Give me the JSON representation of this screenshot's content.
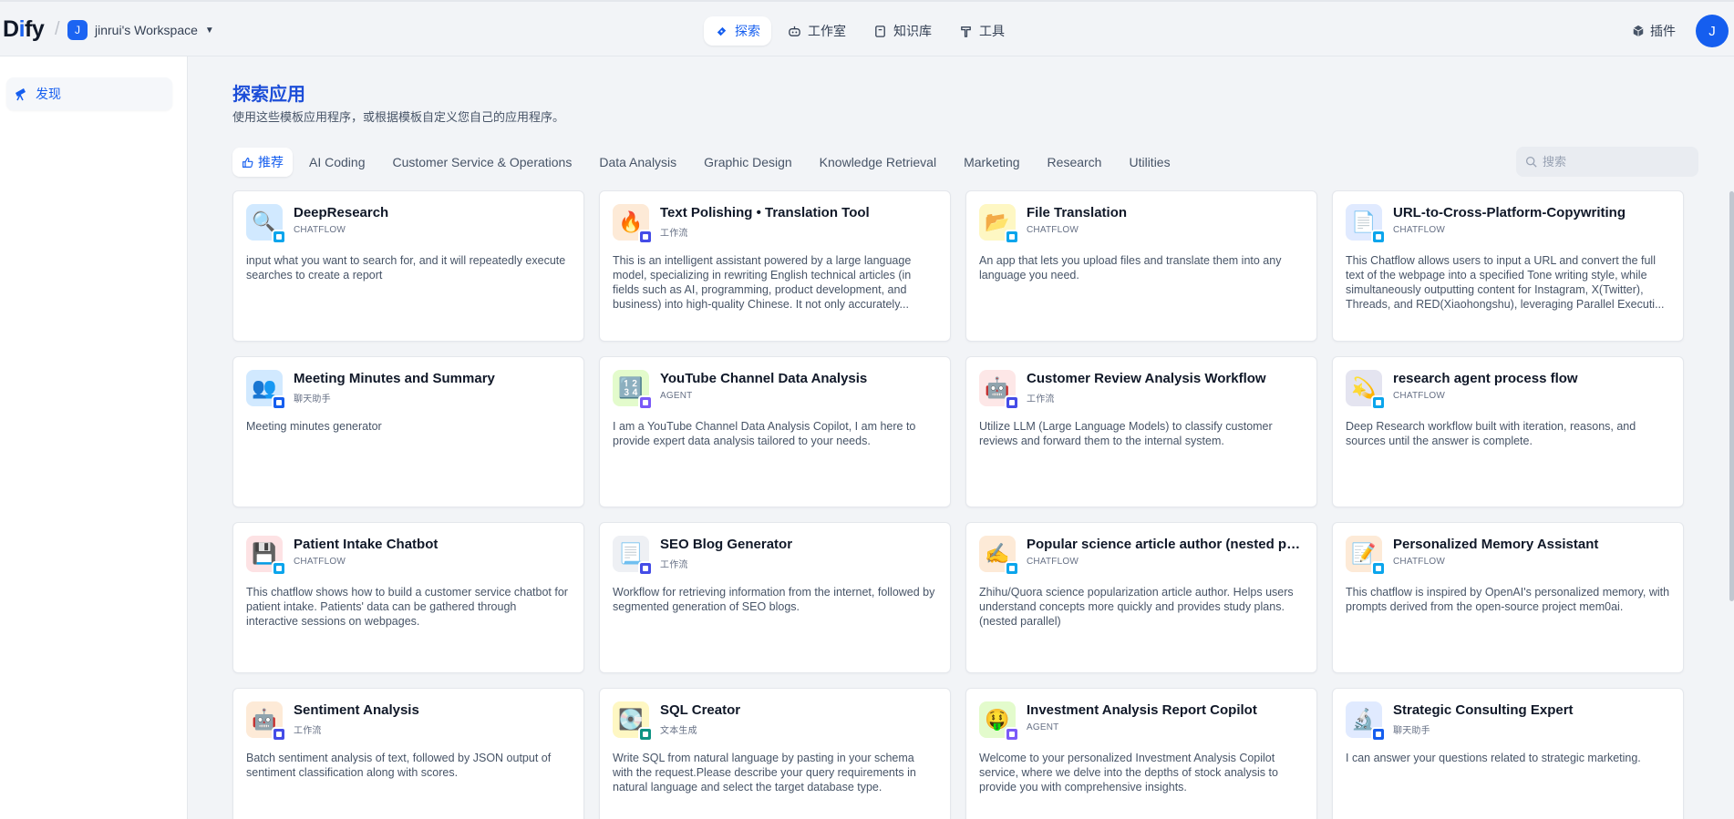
{
  "header": {
    "logo_prefix": "D",
    "logo_i": "i",
    "logo_suffix": "fy",
    "workspace_initial": "J",
    "workspace_name": "jinrui's Workspace",
    "nav": [
      {
        "label": "探索",
        "icon": "compass-icon",
        "active": true
      },
      {
        "label": "工作室",
        "icon": "robot-icon",
        "active": false
      },
      {
        "label": "知识库",
        "icon": "book-icon",
        "active": false
      },
      {
        "label": "工具",
        "icon": "hammer-icon",
        "active": false
      }
    ],
    "plugin_label": "插件",
    "user_initial": "J"
  },
  "sidebar": {
    "items": [
      {
        "label": "发现",
        "icon": "telescope-icon",
        "active": true
      }
    ]
  },
  "main": {
    "title": "探索应用",
    "subtitle": "使用这些模板应用程序，或根据模板自定义您自己的应用程序。",
    "tabs": [
      {
        "label": "推荐",
        "active": true
      },
      {
        "label": "AI Coding"
      },
      {
        "label": "Customer Service & Operations"
      },
      {
        "label": "Data Analysis"
      },
      {
        "label": "Graphic Design"
      },
      {
        "label": "Knowledge Retrieval"
      },
      {
        "label": "Marketing"
      },
      {
        "label": "Research"
      },
      {
        "label": "Utilities"
      }
    ],
    "search_placeholder": "搜索",
    "apps": [
      {
        "title": "DeepResearch",
        "type": "CHATFLOW",
        "desc": "input what you want to search for, and it will repeatedly execute searches to create a report",
        "emoji": "🔍",
        "bg": "#d1e9ff",
        "badge": "#0ba5ec"
      },
      {
        "title": "Text Polishing • Translation Tool",
        "type": "工作流",
        "desc": "This is an intelligent assistant powered by a large language model, specializing in rewriting English technical articles (in fields such as AI, programming, product development, and business) into high-quality Chinese. It not only accurately...",
        "emoji": "🔥",
        "bg": "#fdead7",
        "badge": "#444ce7"
      },
      {
        "title": "File Translation",
        "type": "CHATFLOW",
        "desc": "An app that lets you upload files and translate them into any language you need.",
        "emoji": "📂",
        "bg": "#fef7c3",
        "badge": "#0ba5ec"
      },
      {
        "title": "URL-to-Cross-Platform-Copywriting",
        "type": "CHATFLOW",
        "desc": "This Chatflow allows users to input a URL and convert the full text of the webpage into a specified Tone writing style, while simultaneously outputting content for Instagram, X(Twitter), Threads, and RED(Xiaohongshu), leveraging Parallel Executi...",
        "emoji": "📄",
        "bg": "#e0eaff",
        "badge": "#0ba5ec"
      },
      {
        "title": "Meeting Minutes and Summary",
        "type": "聊天助手",
        "desc": "Meeting minutes generator",
        "emoji": "👥",
        "bg": "#d1e9ff",
        "badge": "#155eef"
      },
      {
        "title": "YouTube Channel Data Analysis",
        "type": "AGENT",
        "desc": "I am a YouTube Channel Data Analysis Copilot, I am here to provide expert data analysis tailored to your needs.",
        "emoji": "🔢",
        "bg": "#e3fbcc",
        "badge": "#7a5af8"
      },
      {
        "title": "Customer Review Analysis Workflow",
        "type": "工作流",
        "desc": "Utilize LLM (Large Language Models) to classify customer reviews and forward them to the internal system.",
        "emoji": "🤖",
        "bg": "#fde7e7",
        "badge": "#444ce7"
      },
      {
        "title": "research agent process flow",
        "type": "CHATFLOW",
        "desc": "Deep Research workflow built with iteration, reasons, and sources until the answer is complete.",
        "emoji": "💫",
        "bg": "#e4e4f0",
        "badge": "#0ba5ec"
      },
      {
        "title": "Patient Intake Chatbot",
        "type": "CHATFLOW",
        "desc": "This chatflow shows how to build a customer service chatbot for patient intake. Patients' data can be gathered through interactive sessions on webpages.",
        "emoji": "💾",
        "bg": "#fde2e4",
        "badge": "#0ba5ec"
      },
      {
        "title": "SEO Blog Generator",
        "type": "工作流",
        "desc": "Workflow for retrieving information from the internet, followed by segmented generation of SEO blogs.",
        "emoji": "📃",
        "bg": "#eef0f4",
        "badge": "#444ce7"
      },
      {
        "title": "Popular science article author (nested parallel)",
        "type": "CHATFLOW",
        "desc": "Zhihu/Quora science popularization article author. Helps users understand concepts more quickly and provides study plans. (nested parallel)",
        "emoji": "✍️",
        "bg": "#fdead7",
        "badge": "#0ba5ec"
      },
      {
        "title": "Personalized Memory Assistant",
        "type": "CHATFLOW",
        "desc": "This chatflow is inspired by OpenAI's personalized memory, with prompts derived from the open-source project mem0ai.",
        "emoji": "📝",
        "bg": "#fdead7",
        "badge": "#0ba5ec"
      },
      {
        "title": "Sentiment Analysis",
        "type": "工作流",
        "desc": "Batch sentiment analysis of text, followed by JSON output of sentiment classification along with scores.",
        "emoji": "🤖",
        "bg": "#fdead7",
        "badge": "#444ce7"
      },
      {
        "title": "SQL Creator",
        "type": "文本生成",
        "desc": "Write SQL from natural language by pasting in your schema with the request.Please describe your query requirements in natural language and select the target database type.",
        "emoji": "💽",
        "bg": "#fef7c3",
        "badge": "#0e9384"
      },
      {
        "title": "Investment Analysis Report Copilot",
        "type": "AGENT",
        "desc": "Welcome to your personalized Investment Analysis Copilot service, where we delve into the depths of stock analysis to provide you with comprehensive insights.",
        "emoji": "🤑",
        "bg": "#e3fbcc",
        "badge": "#7a5af8"
      },
      {
        "title": "Strategic Consulting Expert",
        "type": "聊天助手",
        "desc": "I can answer your questions related to strategic marketing.",
        "emoji": "🔬",
        "bg": "#e0eaff",
        "badge": "#155eef"
      }
    ]
  }
}
